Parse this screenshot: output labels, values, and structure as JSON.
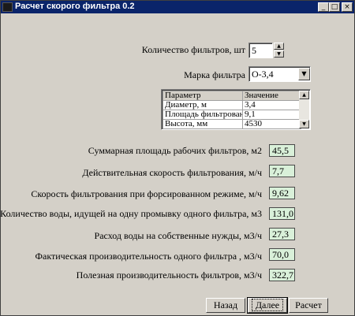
{
  "window": {
    "title": "Расчет скорого фильтра 0.2"
  },
  "filters_count": {
    "label": "Количество фильтров, шт",
    "value": "5"
  },
  "filter_brand": {
    "label": "Марка фильтра",
    "value": "О-3,4"
  },
  "params_table": {
    "headers": [
      "Параметр",
      "Значение"
    ],
    "rows": [
      [
        "Диаметр, м",
        "3,4"
      ],
      [
        "Площадь фильтровани",
        "9,1"
      ],
      [
        "Высота, мм",
        "4530"
      ]
    ]
  },
  "results": [
    {
      "label": "Суммарная площадь рабочих фильтров, м2",
      "value": "45,5"
    },
    {
      "label": "Действительная скорость фильтрования, м/ч",
      "value": "7,7"
    },
    {
      "label": "Скорость фильтрования при форсированном режиме, м/ч",
      "value": "9,62"
    },
    {
      "label": "Количество воды, идущей на одну промывку одного фильтра, м3",
      "value": "131,0"
    },
    {
      "label": "Расход воды на собственные нужды, м3/ч",
      "value": "27,3"
    },
    {
      "label": "Фактическая производительность одного фильтра , м3/ч",
      "value": "70,0"
    },
    {
      "label": "Полезная производительность фильтров, м3/ч",
      "value": "322,7"
    }
  ],
  "buttons": {
    "back": "Назад",
    "next": "Далее",
    "calc": "Расчет"
  }
}
